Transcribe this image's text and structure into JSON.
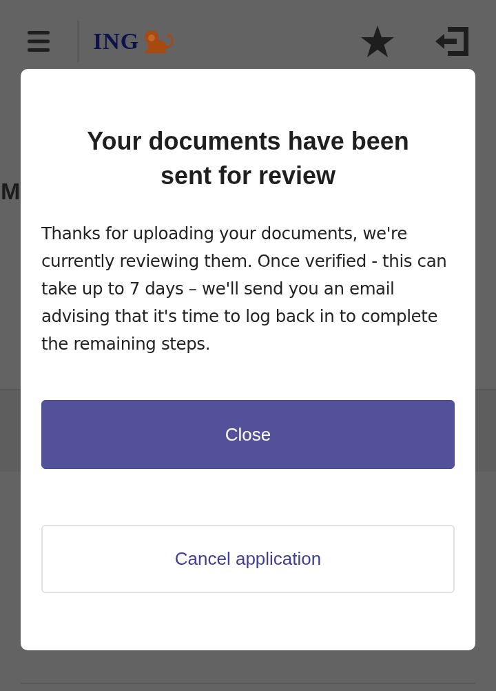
{
  "header": {
    "logo": {
      "text": "ING"
    }
  },
  "page": {
    "heading": "M"
  },
  "modal": {
    "title": "Your documents have been sent for review",
    "body": "Thanks for uploading your documents, we're currently reviewing them. Once verified - this can take up to 7 days – we'll send you an email advising that it's time to log back in to complete the remaining steps.",
    "buttons": [
      {
        "label": "Close",
        "kind": "primary"
      },
      {
        "label": "Cancel application",
        "kind": "secondary"
      }
    ]
  }
}
